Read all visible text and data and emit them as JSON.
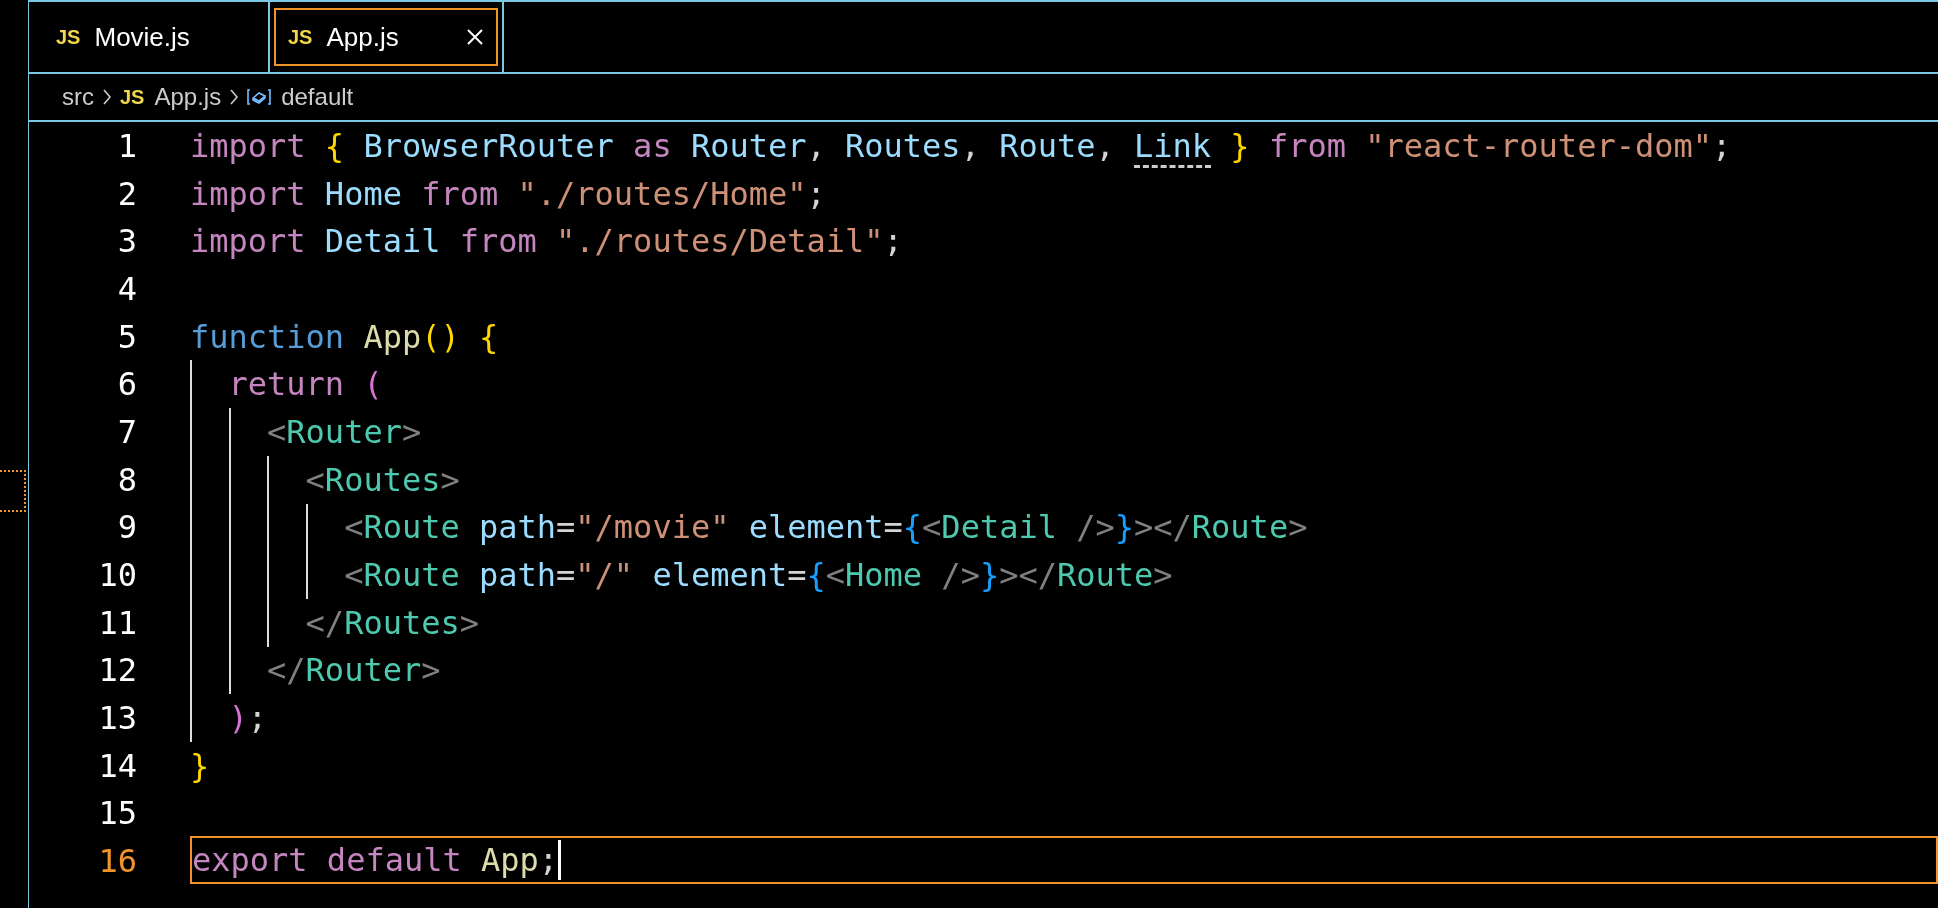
{
  "tabs": [
    {
      "label": "Movie.js",
      "icon": "JS",
      "selected": false
    },
    {
      "label": "App.js",
      "icon": "JS",
      "selected": true
    }
  ],
  "breadcrumb": [
    {
      "kind": "folder",
      "label": "src"
    },
    {
      "kind": "file",
      "icon": "JS",
      "label": "App.js"
    },
    {
      "kind": "symbol",
      "label": "default"
    }
  ],
  "editor": {
    "lines": [
      {
        "number": "1",
        "current": false,
        "tokens": [
          {
            "kind": "keyword",
            "text": "import "
          },
          {
            "kind": "brace",
            "text": "{ "
          },
          {
            "kind": "variable",
            "text": "BrowserRouter "
          },
          {
            "kind": "keyword",
            "text": "as "
          },
          {
            "kind": "variable",
            "text": "Router"
          },
          {
            "kind": "plain",
            "text": ", "
          },
          {
            "kind": "variable",
            "text": "Routes"
          },
          {
            "kind": "plain",
            "text": ", "
          },
          {
            "kind": "variable",
            "text": "Route"
          },
          {
            "kind": "plain",
            "text": ", "
          },
          {
            "kind": "unused",
            "text": "Link"
          },
          {
            "kind": "brace",
            "text": " } "
          },
          {
            "kind": "keyword",
            "text": "from "
          },
          {
            "kind": "string",
            "text": "\"react-router-dom\""
          },
          {
            "kind": "plain",
            "text": ";"
          }
        ]
      },
      {
        "number": "2",
        "current": false,
        "tokens": [
          {
            "kind": "keyword",
            "text": "import "
          },
          {
            "kind": "variable",
            "text": "Home "
          },
          {
            "kind": "keyword",
            "text": "from "
          },
          {
            "kind": "string",
            "text": "\"./routes/Home\""
          },
          {
            "kind": "plain",
            "text": ";"
          }
        ]
      },
      {
        "number": "3",
        "current": false,
        "tokens": [
          {
            "kind": "keyword",
            "text": "import "
          },
          {
            "kind": "variable",
            "text": "Detail "
          },
          {
            "kind": "keyword",
            "text": "from "
          },
          {
            "kind": "string",
            "text": "\"./routes/Detail\""
          },
          {
            "kind": "plain",
            "text": ";"
          }
        ]
      },
      {
        "number": "4",
        "current": false
      },
      {
        "number": "5",
        "current": false,
        "tokens": [
          {
            "kind": "storage",
            "text": "function "
          },
          {
            "kind": "function",
            "text": "App"
          },
          {
            "kind": "brace",
            "text": "() {"
          }
        ]
      },
      {
        "number": "6",
        "current": false,
        "tokens": [
          {
            "kind": "keyword",
            "text": "  return "
          },
          {
            "kind": "paren",
            "text": "("
          }
        ]
      },
      {
        "number": "7",
        "current": false,
        "tokens": [
          {
            "kind": "tagmark",
            "text": "    <"
          },
          {
            "kind": "tag",
            "text": "Router"
          },
          {
            "kind": "tagmark",
            "text": ">"
          }
        ]
      },
      {
        "number": "8",
        "current": false,
        "tokens": [
          {
            "kind": "tagmark",
            "text": "      <"
          },
          {
            "kind": "tag",
            "text": "Routes"
          },
          {
            "kind": "tagmark",
            "text": ">"
          }
        ]
      },
      {
        "number": "9",
        "current": false,
        "tokens": [
          {
            "kind": "tagmark",
            "text": "        <"
          },
          {
            "kind": "tag",
            "text": "Route "
          },
          {
            "kind": "variable",
            "text": "path"
          },
          {
            "kind": "plain",
            "text": "="
          },
          {
            "kind": "string",
            "text": "\"/movie\" "
          },
          {
            "kind": "variable",
            "text": "element"
          },
          {
            "kind": "plain",
            "text": "="
          },
          {
            "kind": "jsxbrace",
            "text": "{"
          },
          {
            "kind": "tagmark",
            "text": "<"
          },
          {
            "kind": "tag",
            "text": "Detail "
          },
          {
            "kind": "tagmark",
            "text": "/>"
          },
          {
            "kind": "jsxbrace",
            "text": "}"
          },
          {
            "kind": "tagmark",
            "text": "></"
          },
          {
            "kind": "tag",
            "text": "Route"
          },
          {
            "kind": "tagmark",
            "text": ">"
          }
        ]
      },
      {
        "number": "10",
        "current": false,
        "tokens": [
          {
            "kind": "tagmark",
            "text": "        <"
          },
          {
            "kind": "tag",
            "text": "Route "
          },
          {
            "kind": "variable",
            "text": "path"
          },
          {
            "kind": "plain",
            "text": "="
          },
          {
            "kind": "string",
            "text": "\"/\" "
          },
          {
            "kind": "variable",
            "text": "element"
          },
          {
            "kind": "plain",
            "text": "="
          },
          {
            "kind": "jsxbrace",
            "text": "{"
          },
          {
            "kind": "tagmark",
            "text": "<"
          },
          {
            "kind": "tag",
            "text": "Home "
          },
          {
            "kind": "tagmark",
            "text": "/>"
          },
          {
            "kind": "jsxbrace",
            "text": "}"
          },
          {
            "kind": "tagmark",
            "text": "></"
          },
          {
            "kind": "tag",
            "text": "Route"
          },
          {
            "kind": "tagmark",
            "text": ">"
          }
        ]
      },
      {
        "number": "11",
        "current": false,
        "tokens": [
          {
            "kind": "tagmark",
            "text": "      </"
          },
          {
            "kind": "tag",
            "text": "Routes"
          },
          {
            "kind": "tagmark",
            "text": ">"
          }
        ]
      },
      {
        "number": "12",
        "current": false,
        "tokens": [
          {
            "kind": "tagmark",
            "text": "    </"
          },
          {
            "kind": "tag",
            "text": "Router"
          },
          {
            "kind": "tagmark",
            "text": ">"
          }
        ]
      },
      {
        "number": "13",
        "current": false,
        "tokens": [
          {
            "kind": "paren",
            "text": "  )"
          },
          {
            "kind": "plain",
            "text": ";"
          }
        ]
      },
      {
        "number": "14",
        "current": false,
        "tokens": [
          {
            "kind": "brace",
            "text": "}"
          }
        ]
      },
      {
        "number": "15",
        "current": false
      },
      {
        "number": "16",
        "current": true,
        "tokens": [
          {
            "kind": "keyword",
            "text": "export default "
          },
          {
            "kind": "function",
            "text": "App"
          },
          {
            "kind": "plain",
            "text": ";"
          }
        ]
      }
    ]
  }
}
